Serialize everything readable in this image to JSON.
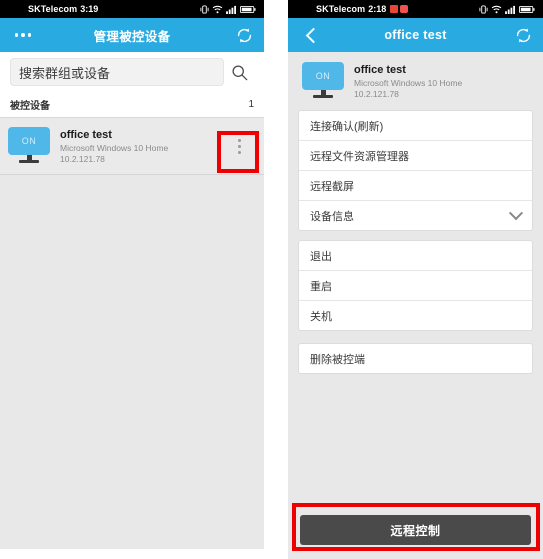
{
  "left_phone": {
    "status_bar": {
      "carrier": "SKTelecom",
      "time": "3:19",
      "icons": [
        "vibrate-icon",
        "wifi-icon",
        "signal-icon",
        "battery-icon"
      ]
    },
    "app_bar": {
      "menu_icon": "overflow-dots-icon",
      "title": "管理被控设备",
      "refresh_icon": "refresh-icon"
    },
    "search": {
      "placeholder": "搜索群组或设备",
      "icon": "search-icon"
    },
    "section": {
      "label": "被控设备",
      "count": "1"
    },
    "devices": [
      {
        "status": "ON",
        "name": "office test",
        "os": "Microsoft Windows 10 Home",
        "ip": "10.2.121.78",
        "menu_icon": "kebab-menu-icon"
      }
    ]
  },
  "right_phone": {
    "status_bar": {
      "carrier": "SKTelecom",
      "time": "2:18",
      "notifications": [
        "alert-icon",
        "message-icon"
      ],
      "icons": [
        "vibrate-icon",
        "wifi-icon",
        "signal-icon",
        "battery-icon"
      ]
    },
    "app_bar": {
      "back_icon": "back-chevron-icon",
      "title": "office test",
      "refresh_icon": "refresh-icon"
    },
    "device": {
      "status": "ON",
      "name": "office test",
      "os": "Microsoft Windows 10 Home",
      "ip": "10.2.121.78"
    },
    "menu_groups": [
      {
        "items": [
          {
            "label": "连接确认(刷新)",
            "accessory": ""
          },
          {
            "label": "远程文件资源管理器",
            "accessory": ""
          },
          {
            "label": "远程截屏",
            "accessory": ""
          },
          {
            "label": "设备信息",
            "accessory": "chevron-down-icon"
          }
        ]
      },
      {
        "items": [
          {
            "label": "退出",
            "accessory": ""
          },
          {
            "label": "重启",
            "accessory": ""
          },
          {
            "label": "关机",
            "accessory": ""
          }
        ]
      },
      {
        "items": [
          {
            "label": "删除被控端",
            "accessory": ""
          }
        ]
      }
    ],
    "primary_button": {
      "label": "远程控制"
    }
  },
  "annotations": {
    "highlight_color": "#ee0000",
    "boxes": [
      "kebab-menu-highlight",
      "remote-control-button-highlight"
    ]
  },
  "colors": {
    "accent_blue": "#29abe2",
    "monitor_blue": "#4fb8e8",
    "button_gray": "#4a4a4a",
    "page_gray": "#e8e8e8"
  }
}
